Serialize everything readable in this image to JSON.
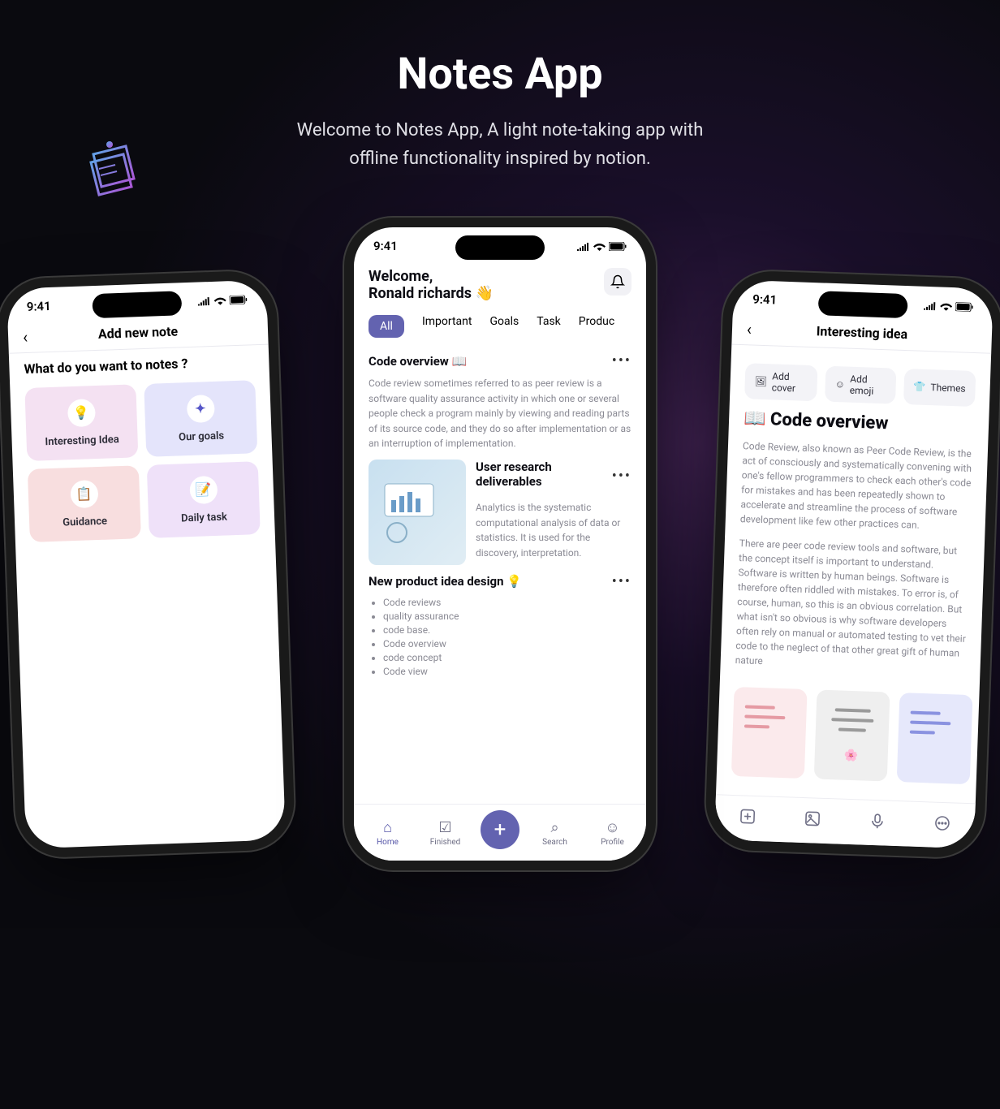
{
  "hero": {
    "title": "Notes App",
    "subtitle_l1": "Welcome to Notes App, A light note-taking app with",
    "subtitle_l2": "offline functionality inspired by notion."
  },
  "status": {
    "time": "9:41"
  },
  "add_note": {
    "header": "Add new note",
    "question": "What do you want to notes ?",
    "tiles": [
      {
        "label": "Interesting Idea",
        "color": "#f4e1f2",
        "icon": "💡"
      },
      {
        "label": "Our goals",
        "color": "#e4e4fb",
        "icon": "✦"
      },
      {
        "label": "Guidance",
        "color": "#f8dedf",
        "icon": "📋"
      },
      {
        "label": "Daily task",
        "color": "#efe1f9",
        "icon": "📝"
      }
    ]
  },
  "home": {
    "welcome": "Welcome,",
    "user": "Ronald richards 👋",
    "tabs": [
      "All",
      "Important",
      "Goals",
      "Task",
      "Produc"
    ],
    "card1": {
      "title": "Code overview 📖",
      "body": "Code review sometimes referred to as peer review is a software quality assurance activity in which one or several people check a program mainly by viewing and reading parts of its source code, and they do so after implementation or as an interruption of implementation."
    },
    "card2": {
      "title": "User research deliverables",
      "body": "Analytics is the systematic computational analysis of data or statistics. It is used for the discovery, interpretation."
    },
    "card3": {
      "title": "New product idea design 💡",
      "bullets": [
        "Code reviews",
        "quality assurance",
        "code base.",
        "Code overview",
        "code concept",
        "Code view"
      ]
    },
    "nav": [
      "Home",
      "Finished",
      "",
      "Search",
      "Profile"
    ]
  },
  "detail": {
    "header": "Interesting idea",
    "pills": [
      {
        "label": "Add cover",
        "icon": "🖼"
      },
      {
        "label": "Add emoji",
        "icon": "☺"
      },
      {
        "label": "Themes",
        "icon": "👕"
      }
    ],
    "title": "📖 Code overview",
    "para1": "Code Review, also known as Peer Code Review, is the act of consciously and systematically convening with one's fellow programmers to check each other's code for mistakes and has been repeatedly shown to accelerate and streamline the process of software development like few other practices can.",
    "para2": "There are peer code review tools and software, but the concept itself is important to understand. Software is written by human beings. Software is therefore often riddled with mistakes. To error is, of course, human, so this is an obvious correlation. But what isn't so obvious is why software developers often rely on manual or automated testing to vet their code to the neglect of that other great gift of human nature"
  }
}
